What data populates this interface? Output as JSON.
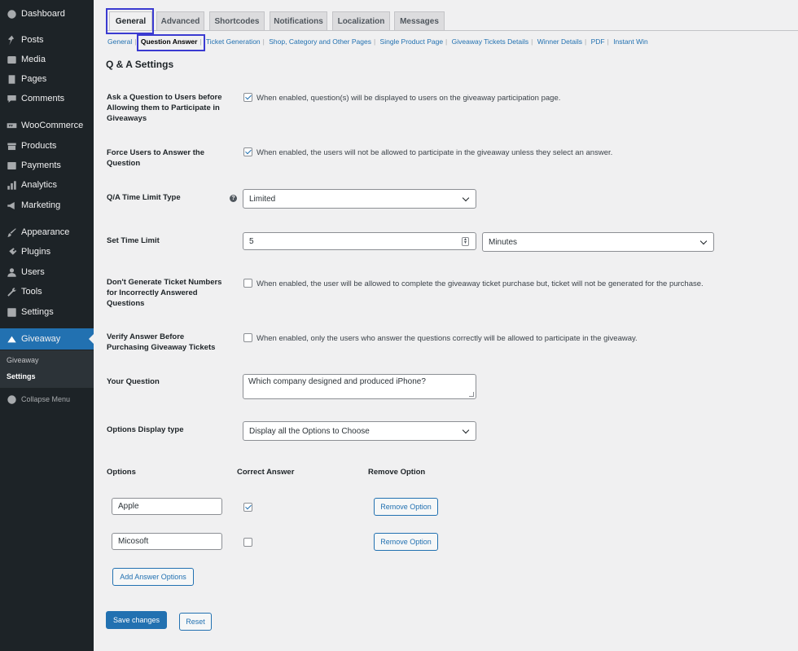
{
  "sidebar": {
    "items": [
      {
        "label": "Dashboard",
        "icon": "dashboard-icon"
      },
      {
        "label": "Posts",
        "icon": "pin-icon"
      },
      {
        "label": "Media",
        "icon": "media-icon"
      },
      {
        "label": "Pages",
        "icon": "pages-icon"
      },
      {
        "label": "Comments",
        "icon": "comment-icon"
      },
      {
        "label": "WooCommerce",
        "icon": "woocommerce-icon"
      },
      {
        "label": "Products",
        "icon": "archive-icon"
      },
      {
        "label": "Payments",
        "icon": "payment-icon"
      },
      {
        "label": "Analytics",
        "icon": "bar-chart-icon"
      },
      {
        "label": "Marketing",
        "icon": "megaphone-icon"
      },
      {
        "label": "Appearance",
        "icon": "brush-icon"
      },
      {
        "label": "Plugins",
        "icon": "plugin-icon"
      },
      {
        "label": "Users",
        "icon": "user-icon"
      },
      {
        "label": "Tools",
        "icon": "wrench-icon"
      },
      {
        "label": "Settings",
        "icon": "settings-icon"
      },
      {
        "label": "Giveaway",
        "icon": "giveaway-icon"
      }
    ],
    "submenu": [
      "Giveaway",
      "Settings"
    ],
    "collapse_label": "Collapse Menu"
  },
  "tabs": [
    "General",
    "Advanced",
    "Shortcodes",
    "Notifications",
    "Localization",
    "Messages"
  ],
  "active_tab": "General",
  "subnav": [
    "General",
    "Question Answer",
    "Ticket Generation",
    "Shop, Category and Other Pages",
    "Single Product Page",
    "Giveaway Tickets Details",
    "Winner Details",
    "PDF",
    "Instant Win"
  ],
  "active_subnav": "Question Answer",
  "section_title": "Q & A Settings",
  "settings": {
    "ask_question": {
      "label": "Ask a Question to Users before Allowing them to Participate in Giveaways",
      "checked": true,
      "description": "When enabled, question(s) will be displayed to users on the giveaway participation page."
    },
    "force_answer": {
      "label": "Force Users to Answer the Question",
      "checked": true,
      "description": "When enabled, the users will not be allowed to participate in the giveaway unless they select an answer."
    },
    "time_limit_type": {
      "label": "Q/A Time Limit Type",
      "value": "Limited"
    },
    "set_time_limit": {
      "label": "Set Time Limit",
      "value": "5",
      "unit": "Minutes"
    },
    "no_ticket_incorrect": {
      "label": "Don't Generate Ticket Numbers for Incorrectly Answered Questions",
      "checked": false,
      "description": "When enabled, the user will be allowed to complete the giveaway ticket purchase but, ticket will not be generated for the purchase."
    },
    "verify_answer": {
      "label": "Verify Answer Before Purchasing Giveaway Tickets",
      "checked": false,
      "description": "When enabled, only the users who answer the questions correctly will be allowed to participate in the giveaway."
    },
    "your_question": {
      "label": "Your Question",
      "value": "Which company designed and produced iPhone?"
    },
    "options_display": {
      "label": "Options Display type",
      "value": "Display all the Options to Choose"
    }
  },
  "options_table": {
    "headers": [
      "Options",
      "Correct Answer",
      "Remove Option"
    ],
    "rows": [
      {
        "option": "Apple",
        "correct": true,
        "remove_label": "Remove Option"
      },
      {
        "option": "Micosoft",
        "correct": false,
        "remove_label": "Remove Option"
      }
    ],
    "add_label": "Add Answer Options"
  },
  "buttons": {
    "save": "Save changes",
    "reset": "Reset"
  },
  "colors": {
    "admin_bar_bg": "#1d2327",
    "accent": "#2271b1",
    "highlight_box": "#3b3bd1"
  }
}
